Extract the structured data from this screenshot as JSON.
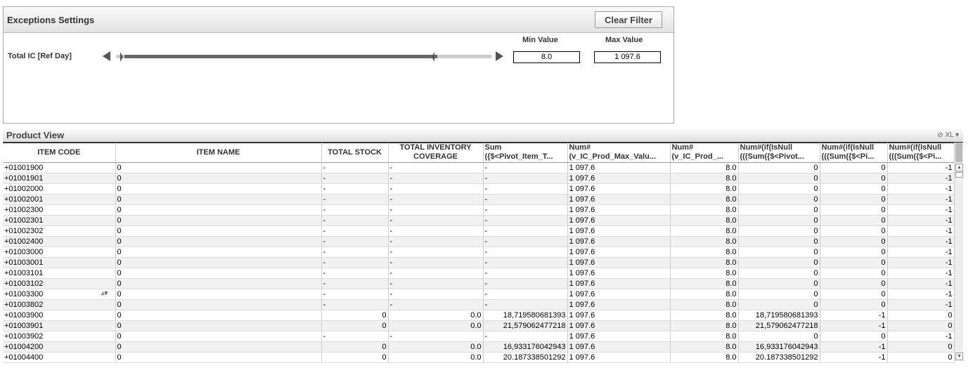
{
  "exceptions": {
    "title": "Exceptions Settings",
    "clear_filter": "Clear Filter",
    "min_label": "Min Value",
    "max_label": "Max Value",
    "slider_label": "Total IC [Ref Day]",
    "min_value": "8.0",
    "max_value": "1 097.6"
  },
  "product_view": {
    "title": "Product View",
    "xl": "XL",
    "columns": [
      "ITEM CODE",
      "ITEM NAME",
      "TOTAL STOCK",
      "TOTAL INVENTORY COVERAGE",
      "Sum ({$<Pivot_Item_T...",
      "Num# (v_IC_Prod_Max_Valu...",
      "Num# (v_IC_Prod_...",
      "Num#(if(IsNull (((Sum({$<Pivot...",
      "Num#(if(IsNull (((Sum({$<Pi...",
      "Num#(if(IsNull (((Sum({$<Pi..."
    ],
    "rows": [
      [
        "+01001900",
        "0",
        "-",
        "-",
        "-",
        "1 097.6",
        "8.0",
        "0",
        "0",
        "-1"
      ],
      [
        "+01001901",
        "0",
        "-",
        "-",
        "-",
        "1 097.6",
        "8.0",
        "0",
        "0",
        "-1"
      ],
      [
        "+01002000",
        "0",
        "-",
        "-",
        "-",
        "1 097.6",
        "8.0",
        "0",
        "0",
        "-1"
      ],
      [
        "+01002001",
        "0",
        "-",
        "-",
        "-",
        "1 097.6",
        "8.0",
        "0",
        "0",
        "-1"
      ],
      [
        "+01002300",
        "0",
        "-",
        "-",
        "-",
        "1 097.6",
        "8.0",
        "0",
        "0",
        "-1"
      ],
      [
        "+01002301",
        "0",
        "-",
        "-",
        "-",
        "1 097.6",
        "8.0",
        "0",
        "0",
        "-1"
      ],
      [
        "+01002302",
        "0",
        "-",
        "-",
        "-",
        "1 097.6",
        "8.0",
        "0",
        "0",
        "-1"
      ],
      [
        "+01002400",
        "0",
        "-",
        "-",
        "-",
        "1 097.6",
        "8.0",
        "0",
        "0",
        "-1"
      ],
      [
        "+01003000",
        "0",
        "-",
        "-",
        "-",
        "1 097.6",
        "8.0",
        "0",
        "0",
        "-1"
      ],
      [
        "+01003001",
        "0",
        "-",
        "-",
        "-",
        "1 097.6",
        "8.0",
        "0",
        "0",
        "-1"
      ],
      [
        "+01003101",
        "0",
        "-",
        "-",
        "-",
        "1 097.6",
        "8.0",
        "0",
        "0",
        "-1"
      ],
      [
        "+01003102",
        "0",
        "-",
        "-",
        "-",
        "1 097.6",
        "8.0",
        "0",
        "0",
        "-1"
      ],
      [
        "+01003300",
        "0",
        "-",
        "-",
        "-",
        "1 097.6",
        "8.0",
        "0",
        "0",
        "-1"
      ],
      [
        "+01003802",
        "0",
        "-",
        "-",
        "-",
        "1 097.6",
        "8.0",
        "0",
        "0",
        "-1"
      ],
      [
        "+01003900",
        "0",
        "0",
        "0.0",
        "18,719580681393",
        "1 097.6",
        "8.0",
        "18,719580681393",
        "-1",
        "0"
      ],
      [
        "+01003901",
        "0",
        "0",
        "0.0",
        "21,579062477218",
        "1 097.6",
        "8.0",
        "21,579062477218",
        "-1",
        "0"
      ],
      [
        "+01003902",
        "0",
        "-",
        "-",
        "-",
        "1 097.6",
        "8.0",
        "0",
        "0",
        "-1"
      ],
      [
        "+01004200",
        "0",
        "0",
        "0.0",
        "16,933176042943",
        "1 097.6",
        "8.0",
        "16,933176042943",
        "-1",
        "0"
      ],
      [
        "+01004400",
        "0",
        "0",
        "0.0",
        "20.187338501292",
        "1 097.6",
        "8.0",
        "20.187338501292",
        "-1",
        "0"
      ]
    ]
  }
}
